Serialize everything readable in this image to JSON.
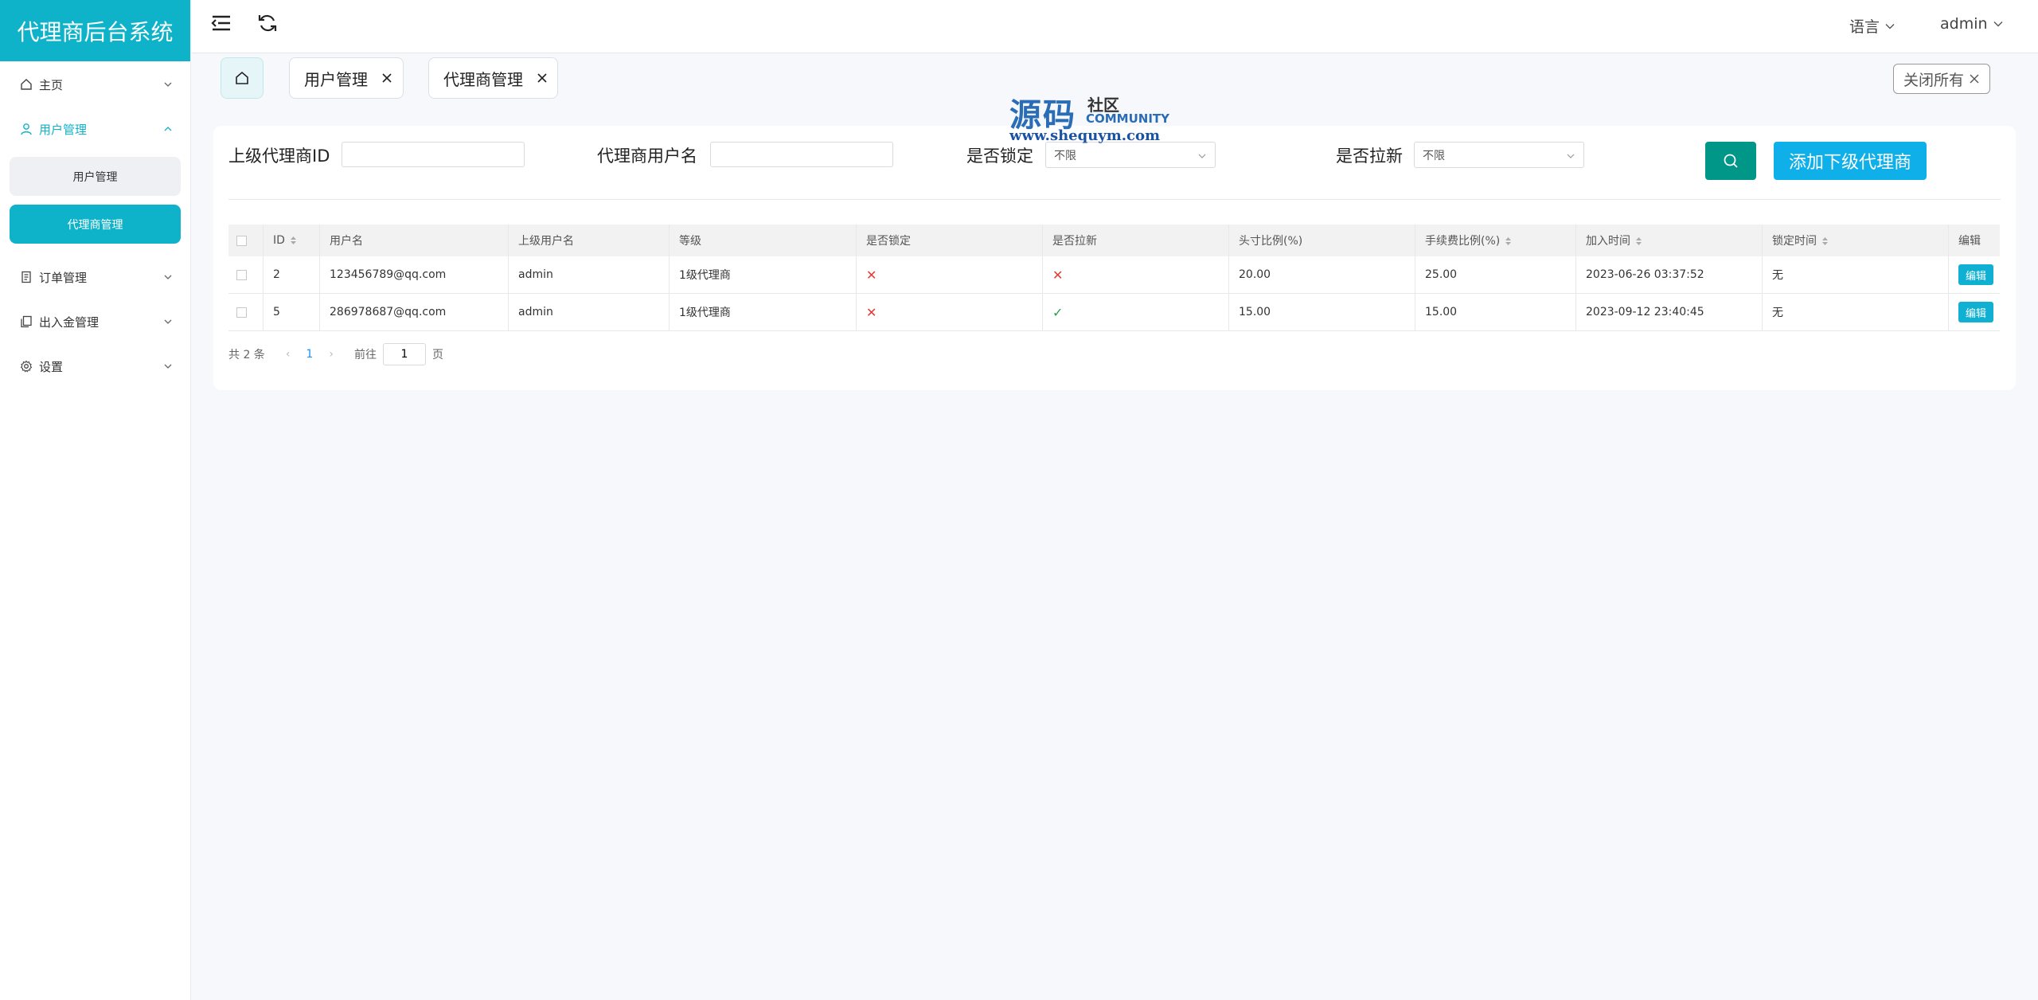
{
  "app": {
    "title": "代理商后台系统",
    "accent_color": "#0fb3c9"
  },
  "sidebar": {
    "items": [
      {
        "label": "主页",
        "icon": "home-icon",
        "open": false
      },
      {
        "label": "用户管理",
        "icon": "user-icon",
        "open": true,
        "children": [
          {
            "label": "用户管理",
            "active": false
          },
          {
            "label": "代理商管理",
            "active": true
          }
        ]
      },
      {
        "label": "订单管理",
        "icon": "document-icon",
        "open": false
      },
      {
        "label": "出入金管理",
        "icon": "copy-icon",
        "open": false
      },
      {
        "label": "设置",
        "icon": "gear-icon",
        "open": false
      }
    ]
  },
  "topbar": {
    "language": "语言",
    "user": "admin",
    "icons": [
      "menu-fold-icon",
      "refresh-icon"
    ]
  },
  "tabs": [
    {
      "label": "",
      "icon": "home-icon",
      "active": true
    },
    {
      "label": "用户管理",
      "closable": true
    },
    {
      "label": "代理商管理",
      "closable": true
    }
  ],
  "close_all": "关闭所有",
  "watermark": {
    "big": "源码",
    "small": "社区",
    "en": "COMMUNITY",
    "url": "www.shequym.com"
  },
  "filters": {
    "parent_id_label": "上级代理商ID",
    "parent_id_value": "",
    "username_label": "代理商用户名",
    "username_value": "",
    "locked_label": "是否锁定",
    "locked_value": "不限",
    "invite_label": "是否拉新",
    "invite_value": "不限"
  },
  "buttons": {
    "search_icon": "search-icon",
    "add": "添加下级代理商",
    "edit": "编辑"
  },
  "table": {
    "columns": [
      "ID",
      "用户名",
      "上级用户名",
      "等级",
      "是否锁定",
      "是否拉新",
      "头寸比例(%)",
      "手续费比例(%)",
      "加入时间",
      "锁定时间",
      "编辑"
    ],
    "rows": [
      {
        "id": "2",
        "username": "123456789@qq.com",
        "parent": "admin",
        "level": "1级代理商",
        "locked": false,
        "invite": false,
        "position_ratio": "20.00",
        "fee_ratio": "25.00",
        "join_time": "2023-06-26 03:37:52",
        "lock_time": "无"
      },
      {
        "id": "5",
        "username": "286978687@qq.com",
        "parent": "admin",
        "level": "1级代理商",
        "locked": false,
        "invite": true,
        "position_ratio": "15.00",
        "fee_ratio": "15.00",
        "join_time": "2023-09-12 23:40:45",
        "lock_time": "无"
      }
    ]
  },
  "pagination": {
    "total": "共 2 条",
    "current_page": "1",
    "goto_label": "前往",
    "goto_value": "1",
    "page_suffix": "页"
  }
}
